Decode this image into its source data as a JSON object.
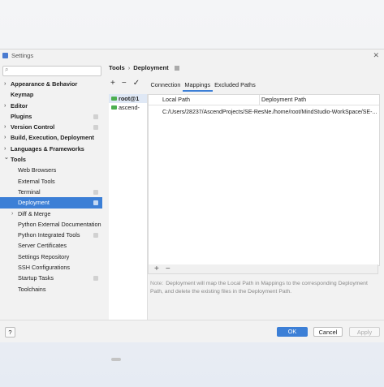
{
  "window": {
    "title": "Settings"
  },
  "search": {
    "placeholder": ""
  },
  "tree": [
    {
      "label": "Appearance & Behavior",
      "bold": true,
      "arrow": true
    },
    {
      "label": "Keymap",
      "bold": true
    },
    {
      "label": "Editor",
      "bold": true,
      "arrow": true
    },
    {
      "label": "Plugins",
      "bold": true,
      "badge": true
    },
    {
      "label": "Version Control",
      "bold": true,
      "arrow": true,
      "badge": true
    },
    {
      "label": "Build, Execution, Deployment",
      "bold": true,
      "arrow": true
    },
    {
      "label": "Languages & Frameworks",
      "bold": true,
      "arrow": true
    },
    {
      "label": "Tools",
      "bold": true,
      "expanded": true
    },
    {
      "label": "Web Browsers",
      "child": true
    },
    {
      "label": "External Tools",
      "child": true
    },
    {
      "label": "Terminal",
      "child": true,
      "badge": true
    },
    {
      "label": "Deployment",
      "child": true,
      "selected": true,
      "badge": true
    },
    {
      "label": "Diff & Merge",
      "child": true,
      "arrow": true
    },
    {
      "label": "Python External Documentation",
      "child": true
    },
    {
      "label": "Python Integrated Tools",
      "child": true,
      "badge": true
    },
    {
      "label": "Server Certificates",
      "child": true
    },
    {
      "label": "Settings Repository",
      "child": true
    },
    {
      "label": "SSH Configurations",
      "child": true
    },
    {
      "label": "Startup Tasks",
      "child": true,
      "badge": true
    },
    {
      "label": "Toolchains",
      "child": true
    }
  ],
  "breadcrumb": {
    "root": "Tools",
    "separator": "›",
    "current": "Deployment"
  },
  "toolbar": {
    "add": "+",
    "remove": "−",
    "check": "✓"
  },
  "tabs": [
    {
      "label": "Connection"
    },
    {
      "label": "Mappings",
      "selected": true
    },
    {
      "label": "Excluded Paths"
    }
  ],
  "servers": [
    {
      "name": "root@1",
      "selected": true
    },
    {
      "name": "ascend-"
    }
  ],
  "mappings": {
    "headers": {
      "local": "Local Path",
      "deployment": "Deployment Path"
    },
    "rows": [
      {
        "local": "C:/Users/28237/AscendProjects/SE-ResNe...",
        "deployment": "/home/root/MindStudio-WorkSpace/SE-..."
      }
    ],
    "add": "+",
    "remove": "−"
  },
  "note": {
    "label": "Note:",
    "text": "Deployment will map the Local Path in Mappings to the corresponding Deployment Path, and delete the existing files in the Deployment Path."
  },
  "buttons": {
    "help": "?",
    "ok": "OK",
    "cancel": "Cancel",
    "apply": "Apply"
  },
  "colors": {
    "accent": "#3c7fd6"
  }
}
